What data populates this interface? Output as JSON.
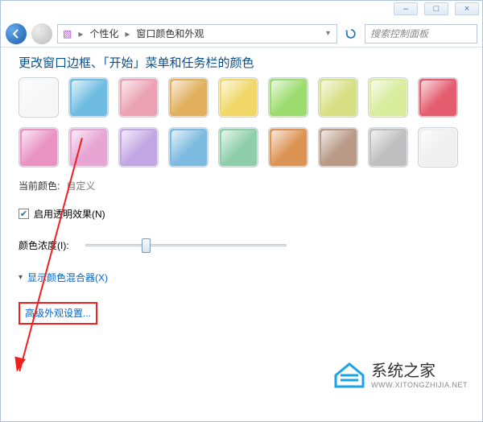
{
  "window_controls": {
    "minimize": "–",
    "maximize": "□",
    "close": "×"
  },
  "breadcrumb": {
    "icon_char": "▧",
    "node1": "个性化",
    "node2": "窗口颜色和外观"
  },
  "search": {
    "placeholder": "搜索控制面板"
  },
  "heading": "更改窗口边框、「开始」菜单和任务栏的颜色",
  "swatches": [
    "#f6f6f6",
    "#6fbce3",
    "#eba1b2",
    "#e1af5d",
    "#f0d768",
    "#9cdc6f",
    "#d7df84",
    "#d8ec9c",
    "#e45d6f",
    "#e992c4",
    "#e7a5d3",
    "#c3a7e4",
    "#7dbadf",
    "#8fceab",
    "#dc9454",
    "#b89a87",
    "#bfbfbf",
    "#efefef"
  ],
  "current_color_label": "当前颜色:",
  "current_color_value": "自定义",
  "transparency_checkbox": {
    "checked": true,
    "label": "启用透明效果(N)"
  },
  "intensity_label": "颜色浓度(I):",
  "show_mixer_checkbox": {
    "checked": false,
    "label": "显示颜色混合器(X)"
  },
  "mixer_arrow": "▾",
  "advanced_link": "高级外观设置...",
  "watermark": {
    "title": "系统之家",
    "sub": "WWW.XITONGZHIJIA.NET"
  }
}
